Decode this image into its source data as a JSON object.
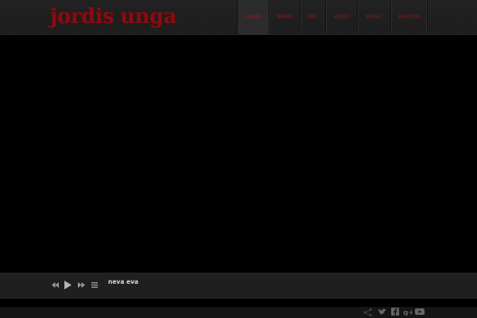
{
  "site": {
    "logo_word1": "jordis",
    "logo_word2": "unga",
    "brand_color": "#8a0c10"
  },
  "nav": {
    "items": [
      {
        "label": "Home",
        "active": true
      },
      {
        "label": "News",
        "active": false
      },
      {
        "label": "Bio",
        "active": false
      },
      {
        "label": "Video",
        "active": false
      },
      {
        "label": "Music",
        "active": false
      },
      {
        "label": "Photos",
        "active": false
      }
    ]
  },
  "player": {
    "track_title": "neva eva",
    "controls": [
      "previous-icon",
      "play-icon",
      "next-icon",
      "playlist-icon"
    ]
  },
  "footer": {
    "social_icons": [
      "share-icon",
      "twitter-icon",
      "facebook-icon",
      "google-plus-icon",
      "youtube-icon"
    ]
  }
}
